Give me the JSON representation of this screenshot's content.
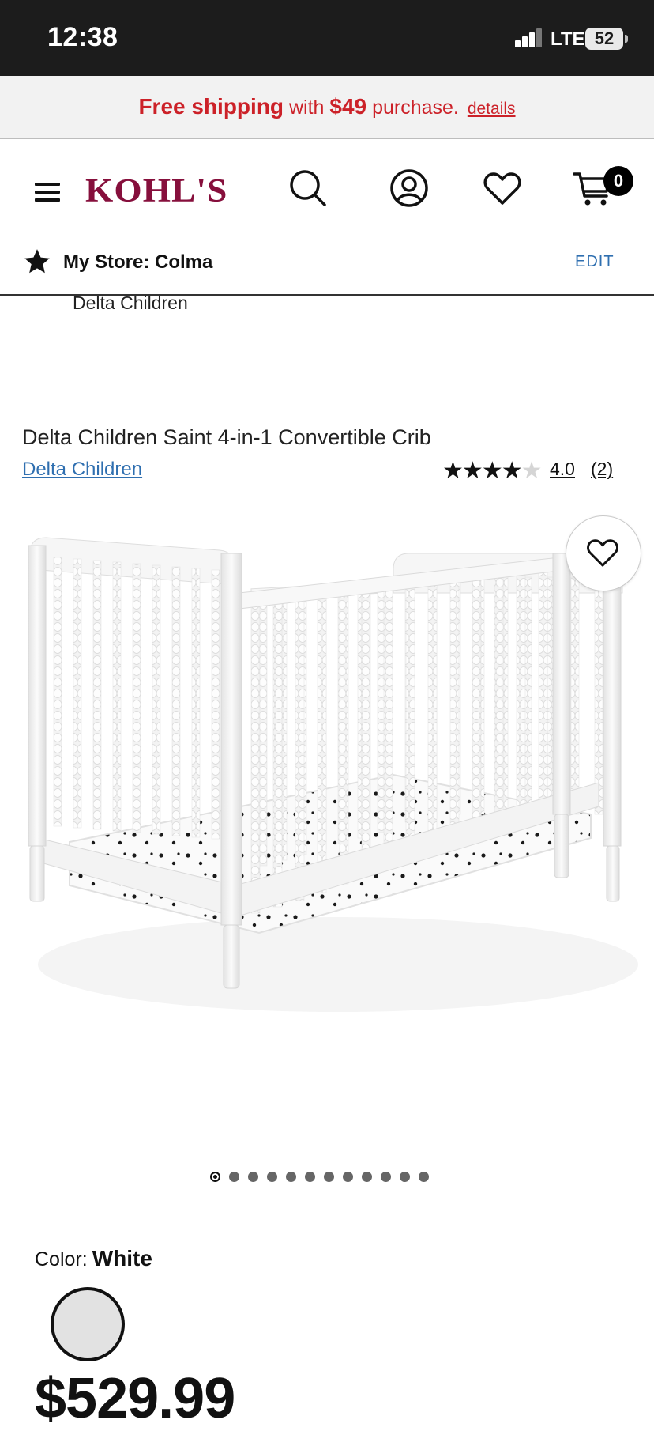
{
  "status_bar": {
    "time": "12:38",
    "network": "LTE",
    "battery": "52"
  },
  "promo": {
    "lead": "Free shipping",
    "mid": "with",
    "amount": "$49",
    "tail": "purchase.",
    "details_link": "details",
    "color": "#cc2128"
  },
  "header": {
    "logo": "KOHL'S",
    "icons": [
      "menu-icon",
      "search-icon",
      "account-icon",
      "heart-icon",
      "cart-icon"
    ],
    "cart_count": "0",
    "brand_color": "#860f3c"
  },
  "store": {
    "label": "My Store: Colma",
    "edit": "EDIT"
  },
  "breadcrumb": "Delta Children",
  "product": {
    "title": "Delta Children Saint 4-in-1 Convertible Crib",
    "brand": "Delta Children",
    "rating_stars_filled": 4,
    "rating_stars_total": 5,
    "rating": "4.0",
    "review_count": "(2)",
    "carousel_count": 12,
    "carousel_active": 0,
    "color_label": "Color:",
    "color_value": "White",
    "price": "$529.99"
  }
}
